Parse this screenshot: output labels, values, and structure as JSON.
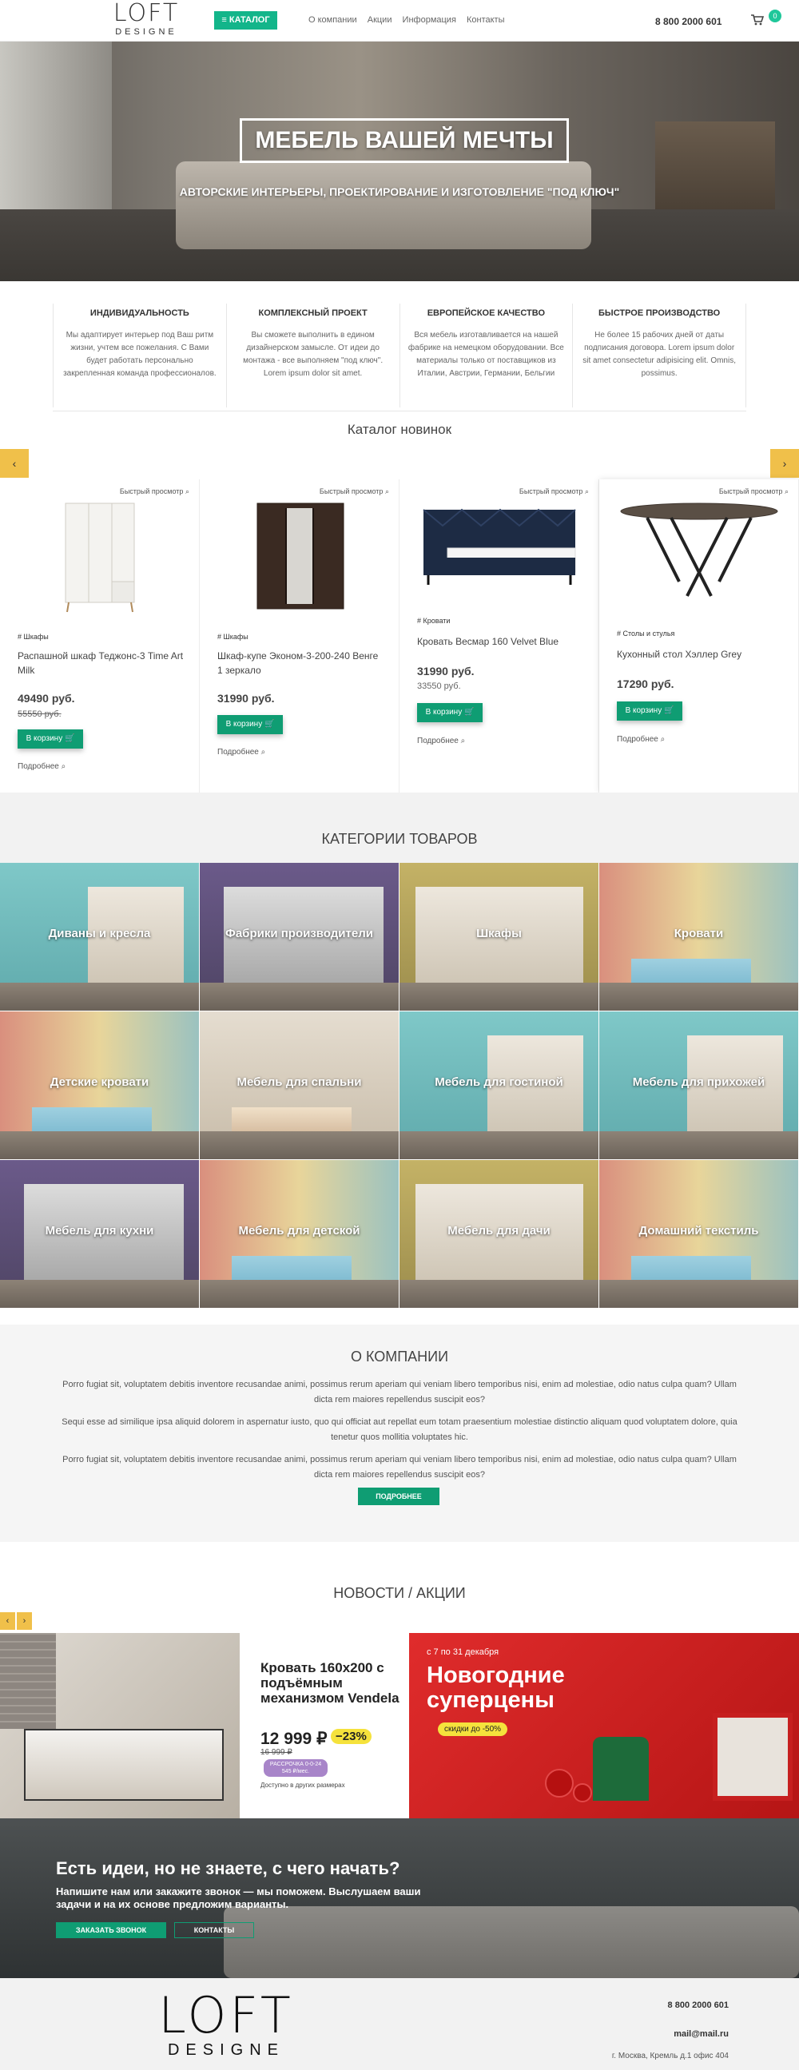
{
  "header": {
    "logo_top": "LOFT",
    "logo_bottom": "DESIGNE",
    "catalog": "≡ КАТАЛОГ",
    "nav": [
      "О компании",
      "Акции",
      "Информация",
      "Контакты"
    ],
    "phone": "8 800 2000 601",
    "cart_count": "0"
  },
  "hero": {
    "title": "МЕБЕЛЬ ВАШЕЙ МЕЧТЫ",
    "subtitle": "АВТОРСКИЕ ИНТЕРЬЕРЫ, ПРОЕКТИРОВАНИЕ И ИЗГОТОВЛЕНИЕ \"ПОД КЛЮЧ\""
  },
  "features": [
    {
      "title": "ИНДИВИДУАЛЬНОСТЬ",
      "text": "Мы адаптирует интерьер под Ваш ритм жизни, учтем все пожелания. С Вами будет работать персонально закрепленная команда профессионалов."
    },
    {
      "title": "КОМПЛЕКСНЫЙ ПРОЕКТ",
      "text": "Вы сможете выполнить в едином дизайнерском замысле. От идеи до монтажа - все выполняем \"под ключ\". Lorem ipsum dolor sit amet."
    },
    {
      "title": "ЕВРОПЕЙСКОЕ КАЧЕСТВО",
      "text": "Вся мебель изготавливается на нашей фабрике на немецком оборудовании. Все материалы только от поставщиков из Италии, Австрии, Германии, Бельгии"
    },
    {
      "title": "БЫСТРОЕ ПРОИЗВОДСТВО",
      "text": "Не более 15 рабочих дней от даты подписания договора. Lorem ipsum dolor sit amet consectetur adipisicing elit. Omnis, possimus."
    }
  ],
  "catalog": {
    "title": "Каталог новинок",
    "quick_view": "Быстрый просмотр",
    "buy_label": "В корзину",
    "more_label": "Подробнее",
    "products": [
      {
        "tag": "# Шкафы",
        "name": "Распашной шкаф Теджонс-3 Time Art Milk",
        "price": "49490 руб.",
        "old": "55550 руб."
      },
      {
        "tag": "# Шкафы",
        "name": "Шкаф-купе Эконом-3-200-240 Венге 1 зеркало",
        "price": "31990 руб.",
        "old": ""
      },
      {
        "tag": "# Кровати",
        "name": "Кровать Весмар 160 Velvet Blue",
        "price": "31990 руб.",
        "old": "33550 руб."
      },
      {
        "tag": "# Столы и стулья",
        "name": "Кухонный стол Хэллер Grey",
        "price": "17290 руб.",
        "old": ""
      }
    ]
  },
  "categories": {
    "title": "КАТЕГОРИИ ТОВАРОВ",
    "items": [
      "Диваны и кресла",
      "Фабрики производители",
      "Шкафы",
      "Кровати",
      "Детские кровати",
      "Мебель для спальни",
      "Мебель для гостиной",
      "Мебель для прихожей",
      "Мебель для кухни",
      "Мебель для детской",
      "Мебель для дачи",
      "Домашний текстиль"
    ]
  },
  "about": {
    "title": "О КОМПАНИИ",
    "p1": "Porro fugiat sit, voluptatem debitis inventore recusandae animi, possimus rerum aperiam qui veniam libero temporibus nisi, enim ad molestiae, odio natus culpa quam? Ullam dicta rem maiores repellendus suscipit eos?",
    "p2": "Sequi esse ad similique ipsa aliquid dolorem in aspernatur iusto, quo qui officiat aut repellat eum totam praesentium molestiae distinctio aliquam quod voluptatem dolore, quia tenetur quos mollitia voluptates hic.",
    "p3": "Porro fugiat sit, voluptatem debitis inventore recusandae animi, possimus rerum aperiam qui veniam libero temporibus nisi, enim ad molestiae, odio natus culpa quam? Ullam dicta rem maiores repellendus suscipit eos?",
    "button": "ПОДРОБНЕЕ"
  },
  "news": {
    "title": "НОВОСТИ / АКЦИИ",
    "banner1": {
      "title": "Кровать 160x200 с подъёмным механизмом Vendela",
      "price": "12 999 ₽",
      "discount": "−23%",
      "old": "16 999 ₽",
      "installment": "РАССРОЧКА 0-0-24 545 ₽/мес.",
      "note": "Доступно в других размерах"
    },
    "banner2": {
      "date": "с 7 по 31 декабря",
      "title": "Новогодние суперцены",
      "discount": "скидки до -50%"
    }
  },
  "cta": {
    "title": "Есть идеи, но не знаете, с чего начать?",
    "text": "Напишите нам или закажите звонок — мы поможем. Выслушаем ваши задачи и на их основе предложим варианты.",
    "call": "ЗАКАЗАТЬ ЗВОНОК",
    "contacts": "КОНТАКТЫ"
  },
  "footer": {
    "logo_top": "LOFT",
    "logo_bottom": "DESIGNE",
    "phone": "8 800 2000 601",
    "email": "mail@mail.ru",
    "address": "г. Москва, Кремль д.1 офис 404"
  },
  "colors": {
    "accent": "#13b58a",
    "button": "#0f9d73",
    "arrow": "#f0c04a"
  }
}
